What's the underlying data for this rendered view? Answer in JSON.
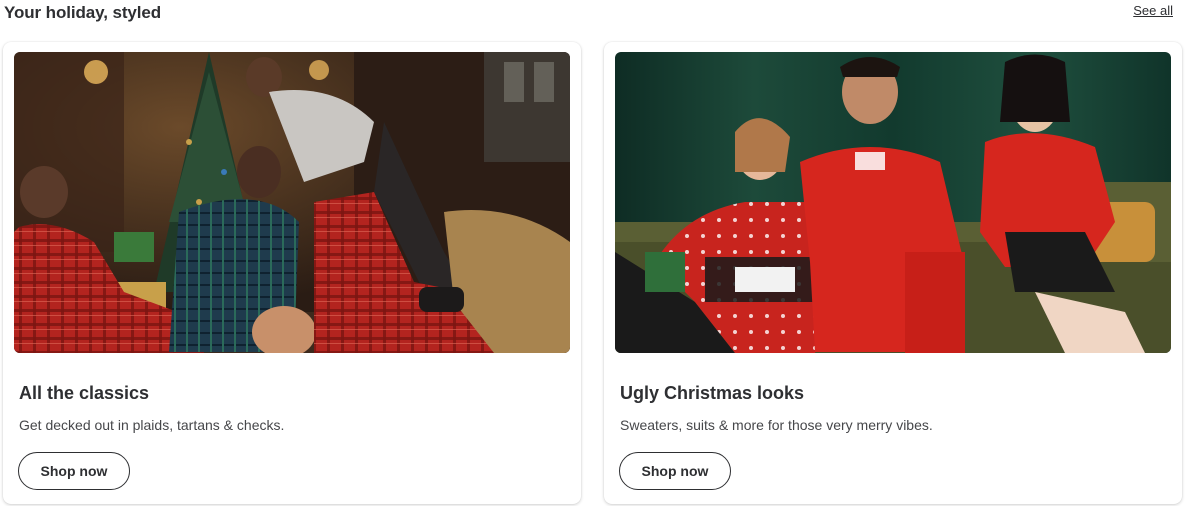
{
  "header": {
    "title": "Your holiday, styled",
    "see_all_label": "See all"
  },
  "cards": [
    {
      "image_alt": "Family in plaid holiday outfits playing by a Christmas tree",
      "title": "All the classics",
      "description": "Get decked out in plaids, tartans & checks.",
      "button_label": "Shop now"
    },
    {
      "image_alt": "Three friends in ugly Christmas sweaters and red tracksuit on a green sofa",
      "title": "Ugly Christmas looks",
      "description": "Sweaters, suits & more for those very merry vibes.",
      "button_label": "Shop now"
    }
  ],
  "colors": {
    "text": "#2e2f32",
    "muted": "#46474a",
    "plaid_red": "#b3241f",
    "velvet_green": "#1d4a3a",
    "tracksuit_red": "#d6261e"
  }
}
